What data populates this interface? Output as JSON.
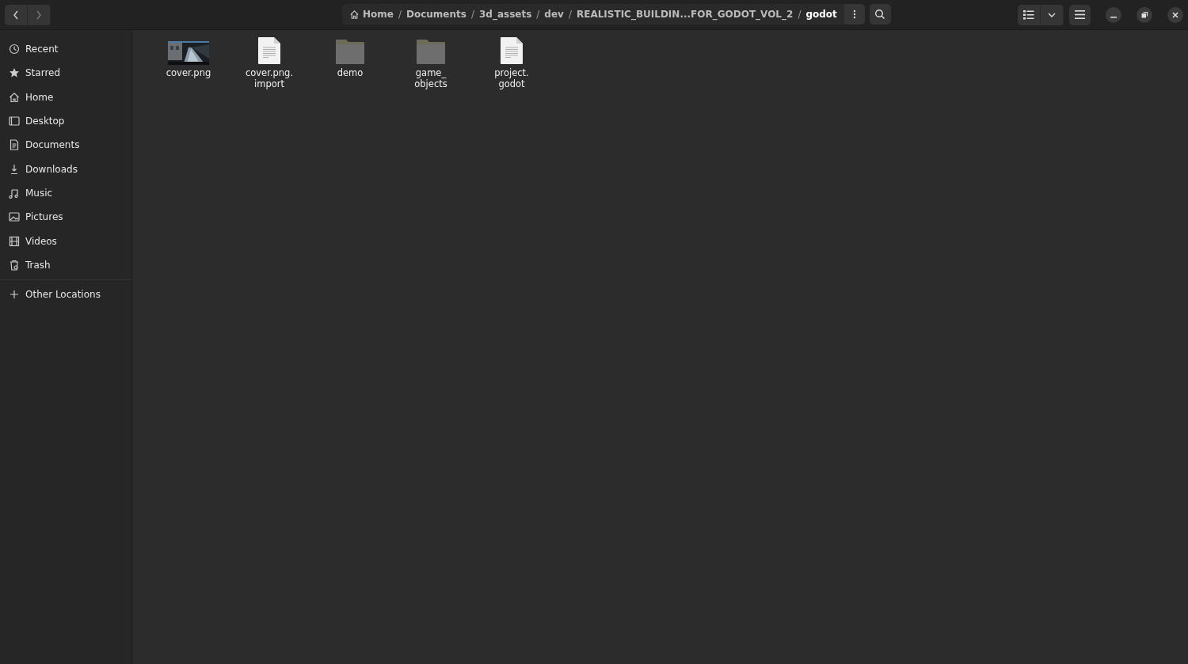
{
  "nav": {
    "back": {
      "disabled": false
    },
    "forward": {
      "disabled": true
    }
  },
  "path": [
    {
      "label": "Home",
      "kind": "home",
      "selected": false
    },
    {
      "separator": "/",
      "label": "Documents",
      "selected": false
    },
    {
      "separator": "/",
      "label": "3d_assets",
      "selected": false
    },
    {
      "separator": "/",
      "label": "dev",
      "selected": false
    },
    {
      "separator": "/",
      "label": "REALISTIC_BUILDIN...FOR_GODOT_VOL_2",
      "selected": false
    },
    {
      "separator": "/",
      "label": "godot",
      "selected": true
    }
  ],
  "sidebar": {
    "items": [
      {
        "label": "Recent",
        "kind": "recent"
      },
      {
        "label": "Starred",
        "kind": "starred"
      },
      {
        "label": "Home",
        "kind": "home"
      },
      {
        "label": "Desktop",
        "kind": "desktop"
      },
      {
        "label": "Documents",
        "kind": "documents"
      },
      {
        "label": "Downloads",
        "kind": "downloads"
      },
      {
        "label": "Music",
        "kind": "music"
      },
      {
        "label": "Pictures",
        "kind": "pictures"
      },
      {
        "label": "Videos",
        "kind": "videos"
      },
      {
        "label": "Trash",
        "kind": "trash"
      }
    ],
    "other": {
      "label": "Other Locations",
      "kind": "plus"
    }
  },
  "files": [
    {
      "lines": [
        "cover.png"
      ],
      "kind": "picture"
    },
    {
      "lines": [
        "cover.png.",
        "import"
      ],
      "kind": "document"
    },
    {
      "lines": [
        "demo"
      ],
      "kind": "folder"
    },
    {
      "lines": [
        "game_",
        "objects"
      ],
      "kind": "folder"
    },
    {
      "lines": [
        "project.",
        "godot"
      ],
      "kind": "document"
    }
  ]
}
